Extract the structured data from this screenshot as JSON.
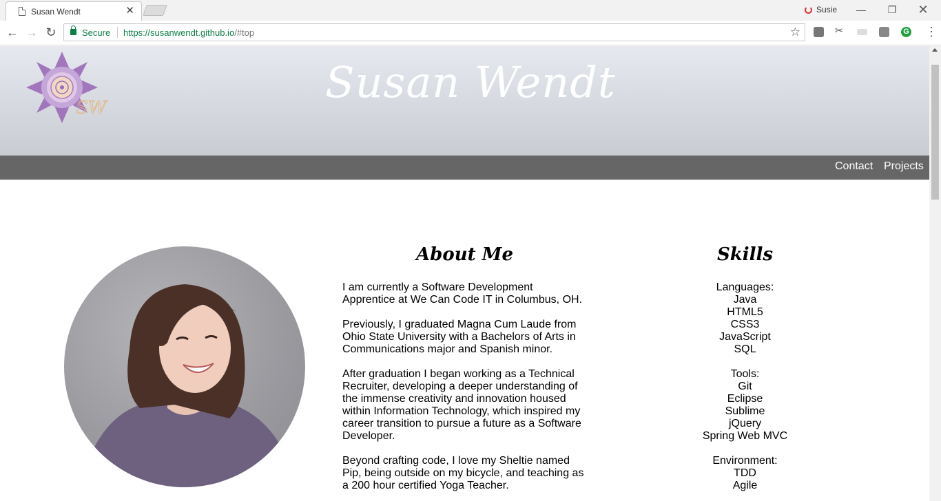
{
  "browser": {
    "tab_title": "Susan Wendt",
    "tab_close": "✕",
    "profile_name": "Susie",
    "security_label": "Secure",
    "url_scheme": "https://",
    "url_host": "susanwendt.github.io",
    "url_path": "/",
    "url_hash": "#top"
  },
  "site": {
    "title": "Susan Wendt",
    "nav": [
      "Contact",
      "Projects"
    ]
  },
  "about": {
    "heading": "About Me",
    "paragraphs": [
      "I am currently a Software Development Apprentice at We Can Code IT in Columbus, OH.",
      "Previously, I graduated Magna Cum Laude from Ohio State University with a Bachelors of Arts in Communications major and Spanish minor.",
      "After graduation I began working as a Technical Recruiter, developing a deeper understanding of the immense creativity and innovation housed within Information Technology, which inspired my career transition to pursue a future as a Software Developer.",
      "Beyond crafting code, I love my Sheltie named Pip, being outside on my bicycle, and teaching as a 200 hour certified Yoga Teacher."
    ]
  },
  "skills": {
    "heading": "Skills",
    "groups": [
      {
        "label": "Languages:",
        "items": [
          "Java",
          "HTML5",
          "CSS3",
          "JavaScript",
          "SQL"
        ]
      },
      {
        "label": "Tools:",
        "items": [
          "Git",
          "Eclipse",
          "Sublime",
          "jQuery",
          "Spring Web MVC"
        ]
      },
      {
        "label": "Environment:",
        "items": [
          "TDD",
          "Agile"
        ]
      }
    ]
  },
  "colors": {
    "navbar": "#666666",
    "secure_green": "#0b8043",
    "logo_purple": "#9b6bb8"
  }
}
